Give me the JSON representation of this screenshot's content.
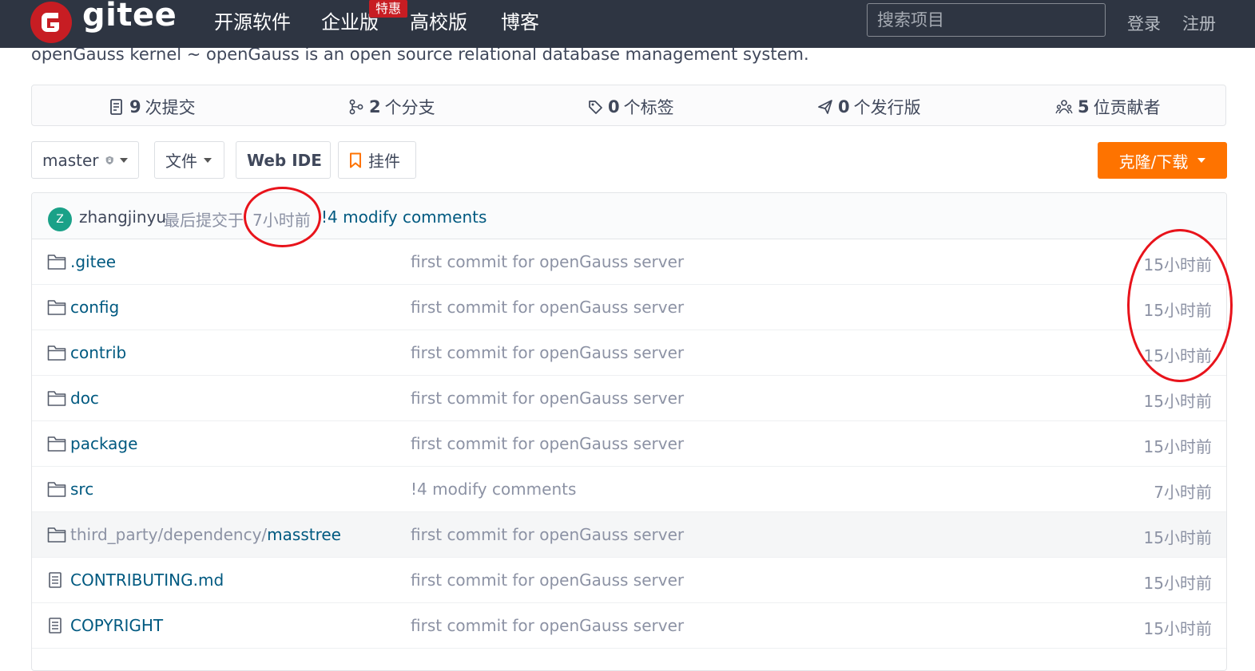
{
  "header": {
    "logo_text": "gitee",
    "nav": [
      "开源软件",
      "企业版",
      "高校版",
      "博客"
    ],
    "promo_badge": "特惠",
    "search_placeholder": "搜索项目",
    "login": "登录",
    "register": "注册"
  },
  "repo": {
    "description": "openGauss kernel ~ openGauss is an open source relational database management system."
  },
  "stats": [
    {
      "icon": "commit-icon",
      "count": "9",
      "label": "次提交"
    },
    {
      "icon": "branch-icon",
      "count": "2",
      "label": "个分支"
    },
    {
      "icon": "tag-icon",
      "count": "0",
      "label": "个标签"
    },
    {
      "icon": "release-icon",
      "count": "0",
      "label": "个发行版"
    },
    {
      "icon": "contributors-icon",
      "count": "5",
      "label": "位贡献者"
    }
  ],
  "toolbar": {
    "branch": "master",
    "file_menu": "文件",
    "web_ide": "Web IDE",
    "widget": "挂件",
    "clone": "克隆/下载"
  },
  "last_commit": {
    "avatar_letter": "Z",
    "author": "zhangjinyu",
    "label": "最后提交于",
    "time": "7小时前",
    "message": "!4 modify comments"
  },
  "files": [
    {
      "type": "folder",
      "name": ".gitee",
      "message": "first commit for openGauss server",
      "time": "15小时前"
    },
    {
      "type": "folder",
      "name": "config",
      "message": "first commit for openGauss server",
      "time": "15小时前"
    },
    {
      "type": "folder",
      "name": "contrib",
      "message": "first commit for openGauss server",
      "time": "15小时前"
    },
    {
      "type": "folder",
      "name": "doc",
      "message": "first commit for openGauss server",
      "time": "15小时前"
    },
    {
      "type": "folder",
      "name": "package",
      "message": "first commit for openGauss server",
      "time": "15小时前"
    },
    {
      "type": "folder",
      "name": "src",
      "message": "!4 modify comments",
      "time": "7小时前"
    },
    {
      "type": "folder",
      "prefix": "third_party/dependency/",
      "name": "masstree",
      "message": "first commit for openGauss server",
      "time": "15小时前"
    },
    {
      "type": "file",
      "name": "CONTRIBUTING.md",
      "message": "first commit for openGauss server",
      "time": "15小时前"
    },
    {
      "type": "file",
      "name": "COPYRIGHT",
      "message": "first commit for openGauss server",
      "time": "15小时前"
    }
  ],
  "colors": {
    "topbar": "#2e3542",
    "brand": "#c71d23",
    "clone_button": "#fe7300",
    "link": "#005980",
    "muted": "#8c92a4",
    "annotation": "#e8131b"
  }
}
